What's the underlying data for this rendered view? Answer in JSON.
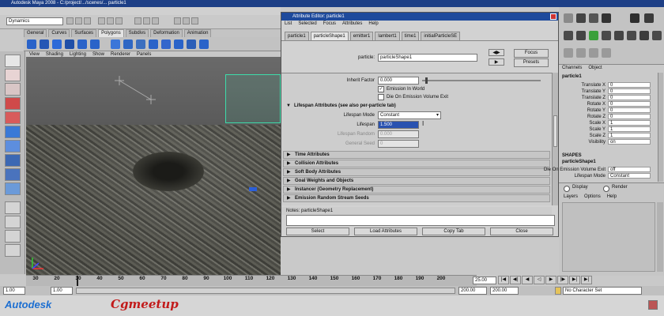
{
  "window": {
    "title": "Autodesk Maya 2008 - C:/project/.../scenes/... particle1"
  },
  "status_line": {
    "mode": "Dynamics"
  },
  "shelf_tabs": [
    "General",
    "Curves",
    "Surfaces",
    "Polygons",
    "Subdivs",
    "Deformation",
    "Animation"
  ],
  "shelf_active": "Polygons",
  "panel_menu": [
    "View",
    "Shading",
    "Lighting",
    "Show",
    "Renderer",
    "Panels"
  ],
  "attribute_editor": {
    "title": "Attribute Editor: particle1",
    "menu": [
      "List",
      "Selected",
      "Focus",
      "Attributes",
      "Help"
    ],
    "tabs": [
      "particle1",
      "particleShape1",
      "emitter1",
      "lambert1",
      "time1",
      "initialParticleSE"
    ],
    "active_tab": "particleShape1",
    "node_label": "particle:",
    "node_value": "particleShape1",
    "focus_button": "Focus",
    "presets_button": "Presets",
    "inherit_factor_label": "Inherit Factor",
    "inherit_factor_value": "0.000",
    "emission_in_world": "Emission In World",
    "die_on_exit": "Die On Emission Volume Exit",
    "lifespan_section": "Lifespan Attributes (see also per-particle tab)",
    "lifespan_mode_label": "Lifespan Mode",
    "lifespan_mode_value": "Constant",
    "lifespan_label": "Lifespan",
    "lifespan_value": "1.500",
    "lifespan_random_label": "Lifespan Random",
    "lifespan_random_value": "0.000",
    "general_seed_label": "General Seed",
    "general_seed_value": "0",
    "sections": [
      "Time Attributes",
      "Collision Attributes",
      "Soft Body Attributes",
      "Goal Weights and Objects",
      "Instancer (Geometry Replacement)",
      "Emission Random Stream Seeds"
    ],
    "notes_label": "Notes: particleShape1",
    "buttons": [
      "Select",
      "Load Attributes",
      "Copy Tab",
      "Close"
    ]
  },
  "channel_box": {
    "menu": [
      "Channels",
      "Object"
    ],
    "node": "particle1",
    "rows": [
      {
        "k": "Translate X",
        "v": "0"
      },
      {
        "k": "Translate Y",
        "v": "0"
      },
      {
        "k": "Translate Z",
        "v": "0"
      },
      {
        "k": "Rotate X",
        "v": "0"
      },
      {
        "k": "Rotate Y",
        "v": "0"
      },
      {
        "k": "Rotate Z",
        "v": "0"
      },
      {
        "k": "Scale X",
        "v": "1"
      },
      {
        "k": "Scale Y",
        "v": "1"
      },
      {
        "k": "Scale Z",
        "v": "1"
      },
      {
        "k": "Visibility",
        "v": "on"
      }
    ],
    "shapes_label": "SHAPES",
    "shape_node": "particleShape1",
    "shape_rows": [
      {
        "k": "Die On Emission Volume Exit",
        "v": "off"
      },
      {
        "k": "Lifespan Mode",
        "v": "Constant"
      }
    ]
  },
  "layer_editor": {
    "display": "Display",
    "render": "Render",
    "menu": [
      "Layers",
      "Options",
      "Help"
    ]
  },
  "timeline": {
    "ticks": [
      "30",
      "20",
      "30",
      "40",
      "50",
      "60",
      "70",
      "80",
      "90",
      "100",
      "110",
      "120",
      "130",
      "140",
      "150",
      "160",
      "170",
      "180",
      "190",
      "200"
    ],
    "current": "25.00"
  },
  "range": {
    "start": "1.00",
    "inner_start": "1.00",
    "inner_end": "200.00",
    "end": "200.00",
    "character_set": "No Character Set"
  },
  "logos": {
    "autodesk": "Autodesk",
    "brand": "Cgmeetup"
  }
}
